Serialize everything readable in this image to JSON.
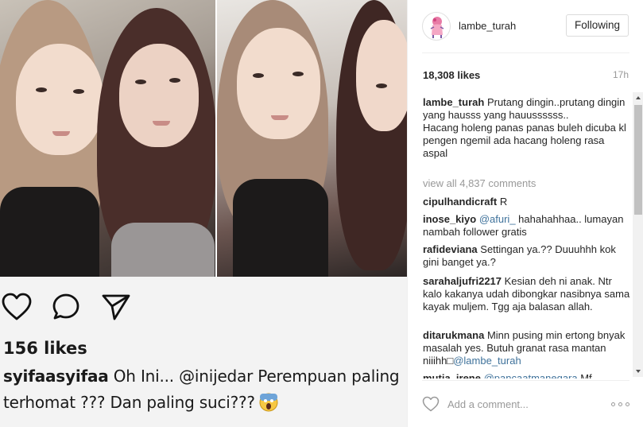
{
  "header": {
    "username": "lambe_turah",
    "follow_label": "Following"
  },
  "stats": {
    "likes": "18,308 likes",
    "time": "17h"
  },
  "caption": {
    "user": "lambe_turah",
    "text": "Prutang dingin..prutang dingin\nyang hausss yang hauussssss..\nHacang holeng panas panas buleh dicuba kl pengen ngemil ada hacang holeng rasa aspal"
  },
  "view_all_comments": "view all 4,837 comments",
  "comments": [
    {
      "user": "cipulhandicraft",
      "text": "R"
    },
    {
      "user": "inose_kiyo",
      "mention": "@afuri_",
      "text": " hahahahhaa.. lumayan nambah follower gratis"
    },
    {
      "user": "rafideviana",
      "text": "Settingan ya.?? Duuuhhh kok gini banget ya.?"
    },
    {
      "user": "sarahaljufri2217",
      "text": "Kesian deh ni anak. Ntr kalo kakanya udah dibongkar nasibnya sama kayak muljem. Tgg aja balasan allah."
    },
    {
      "user": "ditarukmana",
      "text": "Minn pusing min ertong bnyak masalah yes. Butuh granat rasa mantan niiihh□",
      "mention_after": "@lambe_turah"
    },
    {
      "user": "mutia_irene",
      "mention": "@pancaatmanegara",
      "text": " Mf"
    }
  ],
  "comment_box": {
    "placeholder": "Add a comment..."
  },
  "embedded_post": {
    "likes": "156 likes",
    "user": "syifaasyifaa",
    "text_before": "Oh Ini... ",
    "mention": "@inijedar",
    "text_after": " Perempuan paling terhomat ??? Dan paling suci???"
  },
  "icons": {
    "embedded": [
      "heart-icon",
      "comment-icon",
      "share-icon"
    ],
    "panel": [
      "heart-outline-icon",
      "more-options-icon"
    ]
  },
  "colors": {
    "mention": "#3f729b",
    "muted": "#999999",
    "text": "#262626"
  }
}
